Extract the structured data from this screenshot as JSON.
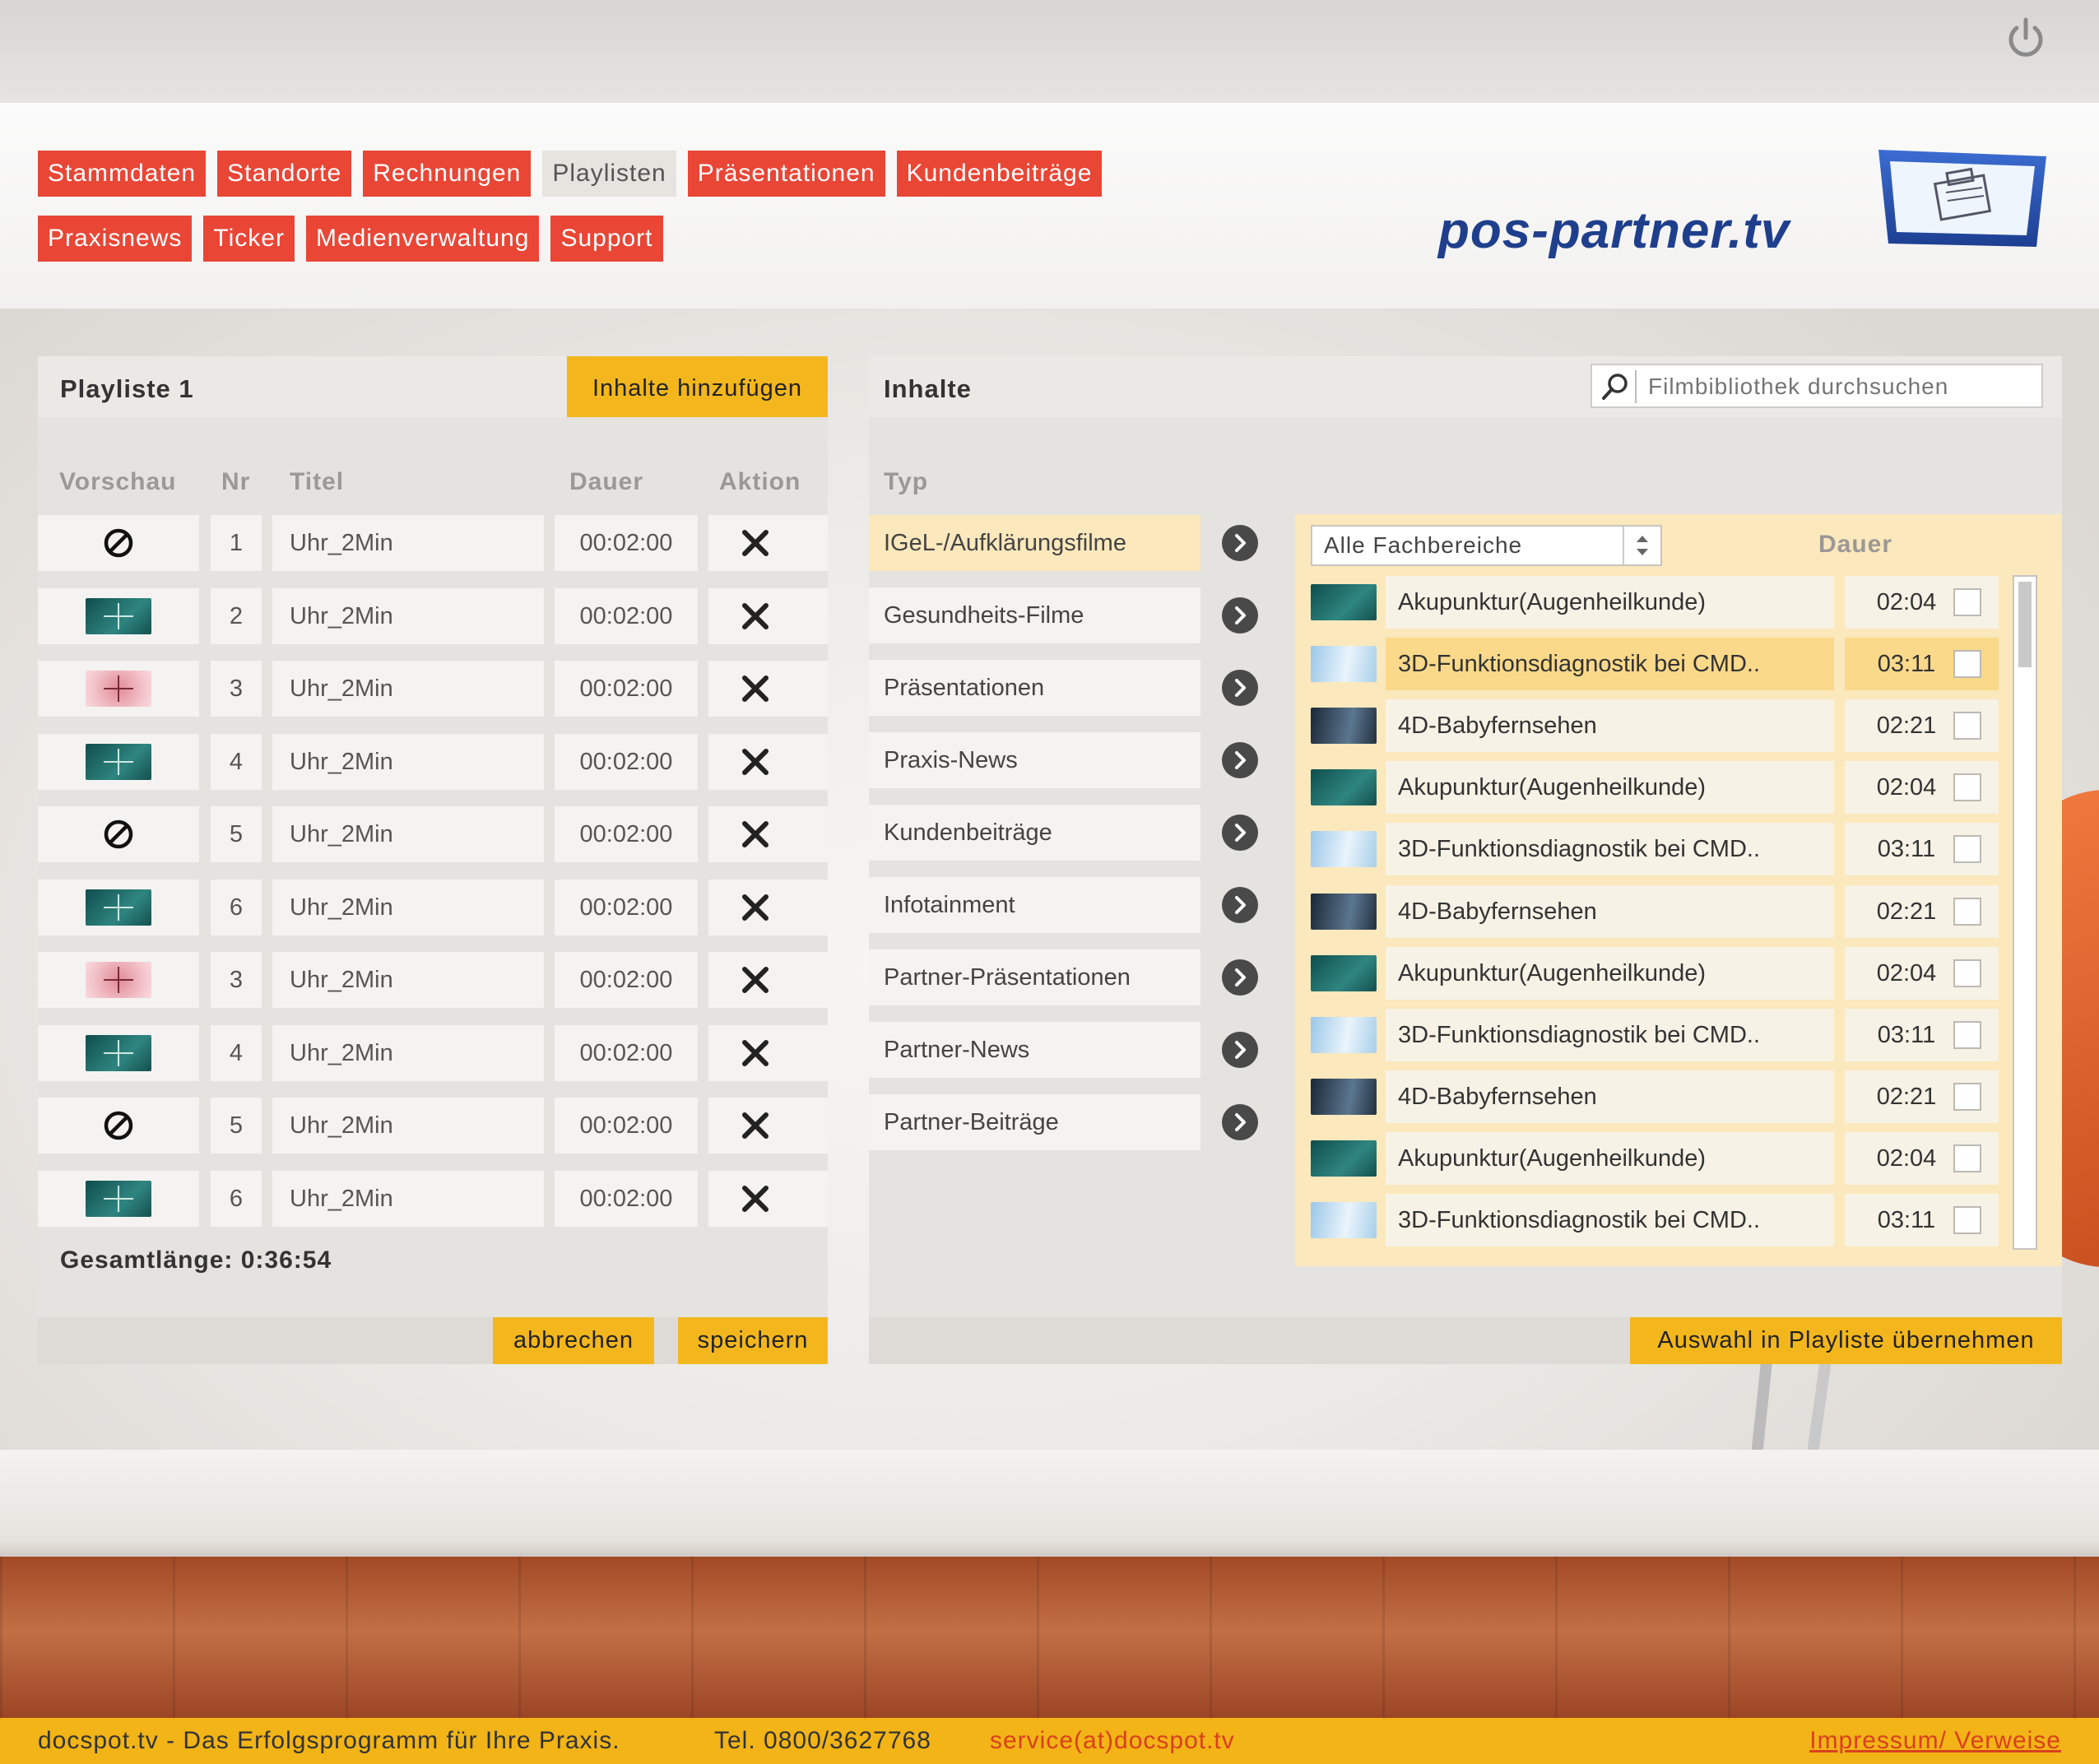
{
  "nav": {
    "row1": [
      "Stammdaten",
      "Standorte",
      "Rechnungen",
      "Playlisten",
      "Präsentationen",
      "Kundenbeiträge"
    ],
    "row2": [
      "Praxisnews",
      "Ticker",
      "Medienverwaltung",
      "Support"
    ],
    "active": "Playlisten"
  },
  "logo": {
    "text": "pos-partner.tv"
  },
  "playlist": {
    "title": "Playliste 1",
    "add_button": "Inhalte hinzufügen",
    "columns": [
      "Vorschau",
      "Nr",
      "Titel",
      "Dauer",
      "Aktion"
    ],
    "rows": [
      {
        "preview": "none",
        "nr": "1",
        "title": "Uhr_2Min",
        "duration": "00:02:00"
      },
      {
        "preview": "teal",
        "nr": "2",
        "title": "Uhr_2Min",
        "duration": "00:02:00"
      },
      {
        "preview": "pink",
        "nr": "3",
        "title": "Uhr_2Min",
        "duration": "00:02:00"
      },
      {
        "preview": "teal",
        "nr": "4",
        "title": "Uhr_2Min",
        "duration": "00:02:00"
      },
      {
        "preview": "none",
        "nr": "5",
        "title": "Uhr_2Min",
        "duration": "00:02:00"
      },
      {
        "preview": "teal",
        "nr": "6",
        "title": "Uhr_2Min",
        "duration": "00:02:00"
      },
      {
        "preview": "pink",
        "nr": "3",
        "title": "Uhr_2Min",
        "duration": "00:02:00"
      },
      {
        "preview": "teal",
        "nr": "4",
        "title": "Uhr_2Min",
        "duration": "00:02:00"
      },
      {
        "preview": "none",
        "nr": "5",
        "title": "Uhr_2Min",
        "duration": "00:02:00"
      },
      {
        "preview": "teal",
        "nr": "6",
        "title": "Uhr_2Min",
        "duration": "00:02:00"
      }
    ],
    "total": "Gesamtlänge: 0:36:54",
    "cancel_button": "abbrechen",
    "save_button": "speichern"
  },
  "content": {
    "title": "Inhalte",
    "search_placeholder": "Filmbibliothek durchsuchen",
    "type_header": "Typ",
    "types": [
      "IGeL-/Aufklärungsfilme",
      "Gesundheits-Filme",
      "Präsentationen",
      "Praxis-News",
      "Kundenbeiträge",
      "Infotainment",
      "Partner-Präsentationen",
      "Partner-News",
      "Partner-Beiträge"
    ],
    "selected_type": 0,
    "filter_value": "Alle Fachbereiche",
    "duration_header": "Dauer",
    "films": [
      {
        "title": "Akupunktur(Augenheilkunde)",
        "duration": "02:04",
        "thumb": "teal"
      },
      {
        "title": "3D-Funktionsdiagnostik bei CMD..",
        "duration": "03:11",
        "thumb": "sky"
      },
      {
        "title": "4D-Babyfernsehen",
        "duration": "02:21",
        "thumb": "baby"
      },
      {
        "title": "Akupunktur(Augenheilkunde)",
        "duration": "02:04",
        "thumb": "teal"
      },
      {
        "title": "3D-Funktionsdiagnostik bei CMD..",
        "duration": "03:11",
        "thumb": "sky"
      },
      {
        "title": "4D-Babyfernsehen",
        "duration": "02:21",
        "thumb": "baby"
      },
      {
        "title": "Akupunktur(Augenheilkunde)",
        "duration": "02:04",
        "thumb": "teal"
      },
      {
        "title": "3D-Funktionsdiagnostik bei CMD..",
        "duration": "03:11",
        "thumb": "sky"
      },
      {
        "title": "4D-Babyfernsehen",
        "duration": "02:21",
        "thumb": "baby"
      },
      {
        "title": "Akupunktur(Augenheilkunde)",
        "duration": "02:04",
        "thumb": "teal"
      },
      {
        "title": "3D-Funktionsdiagnostik bei CMD..",
        "duration": "03:11",
        "thumb": "sky"
      }
    ],
    "highlighted_film": 1,
    "apply_button": "Auswahl in Playliste übernehmen"
  },
  "footer": {
    "slogan": "docspot.tv - Das Erfolgsprogramm für Ihre Praxis.",
    "phone": "Tel. 0800/3627768",
    "email": "service(at)docspot.tv",
    "link": "Impressum/ Verweise"
  },
  "colors": {
    "nav_red": "#e94636",
    "accent_yellow": "#f3b71d",
    "selection": "#fbe8bc",
    "logo_blue": "#1f3f8c"
  },
  "icons": {
    "power": "power-icon",
    "search": "search-icon",
    "delete": "close-icon",
    "arrow": "chevron-right-icon",
    "no_preview": "no-entry-icon"
  }
}
